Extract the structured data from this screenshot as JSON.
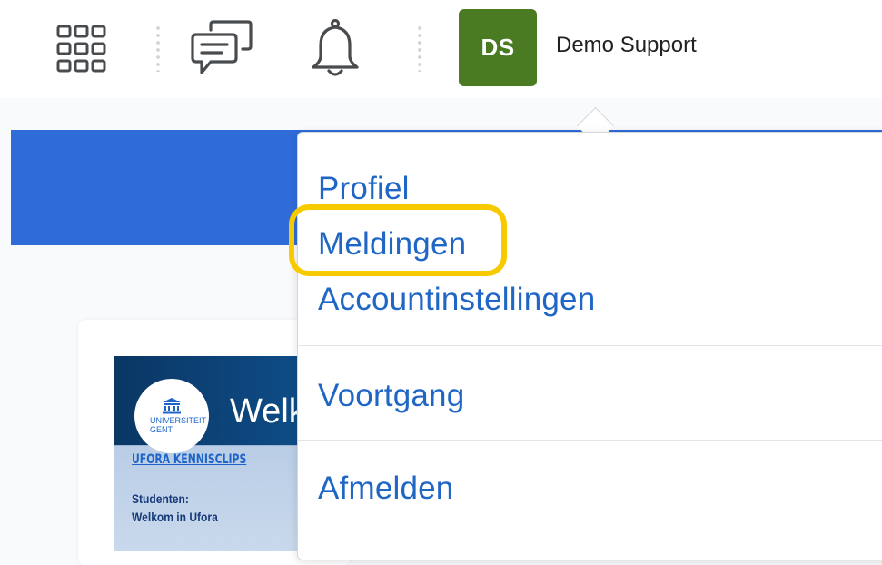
{
  "header": {
    "apps_icon": "grid-icon",
    "messages_icon": "chat-icon",
    "notifications_icon": "bell-icon",
    "avatar_initials": "DS",
    "avatar_color": "#4a7b23",
    "user_name": "Demo Support"
  },
  "menu": {
    "items": [
      {
        "label": "Profiel"
      },
      {
        "label": "Meldingen",
        "highlighted": true
      },
      {
        "label": "Accountinstellingen"
      },
      {
        "label": "Voortgang"
      },
      {
        "label": "Afmelden"
      }
    ],
    "link_color": "#1f66c5",
    "highlight_color": "#f7ca00"
  },
  "content": {
    "banner_color": "#2f6bd9",
    "thumbnail": {
      "logo_line1": "UNIVERSITEIT",
      "logo_line2": "GENT",
      "welcome_text": "Welk",
      "category": "UFORA KENNISCLIPS",
      "subtitle_line1": "Studenten:",
      "subtitle_line2": "Welkom in Ufora"
    }
  }
}
